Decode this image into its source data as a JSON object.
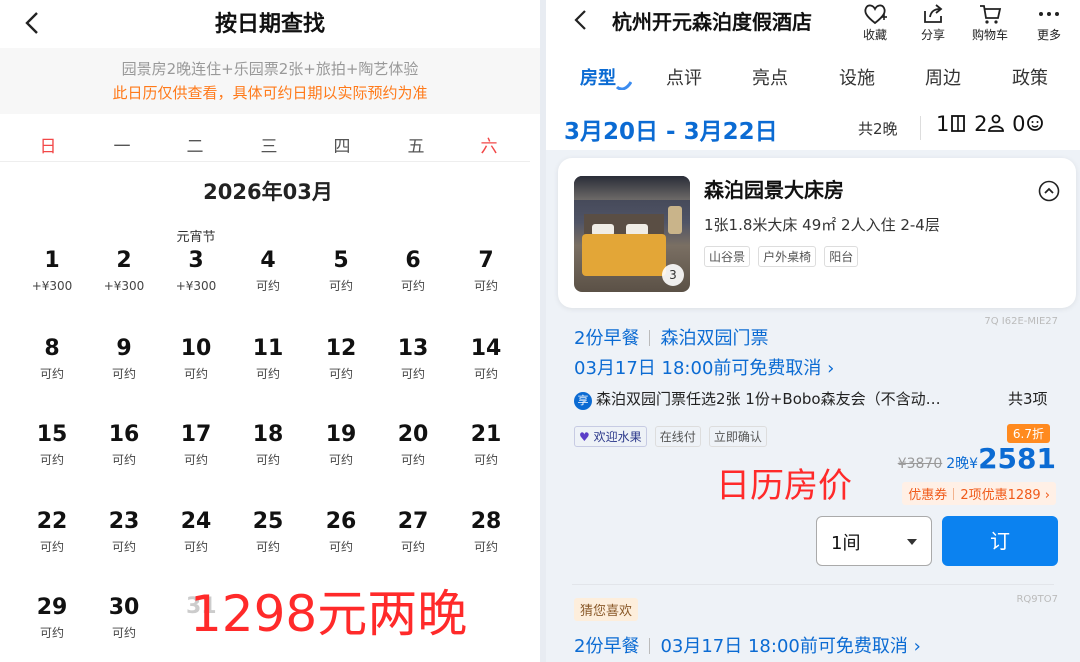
{
  "left": {
    "title": "按日期查找",
    "notice_line1": "园景房2晚连住+乐园票2张+旅拍+陶艺体验",
    "notice_line2": "此日历仅供查看，具体可约日期以实际预约为准",
    "weekdays": [
      "日",
      "一",
      "二",
      "三",
      "四",
      "五",
      "六"
    ],
    "month": "2026年03月",
    "days": [
      {
        "num": "1",
        "sub": "+¥300",
        "festival": ""
      },
      {
        "num": "2",
        "sub": "+¥300",
        "festival": ""
      },
      {
        "num": "3",
        "sub": "+¥300",
        "festival": "元宵节"
      },
      {
        "num": "4",
        "sub": "可约",
        "festival": ""
      },
      {
        "num": "5",
        "sub": "可约",
        "festival": ""
      },
      {
        "num": "6",
        "sub": "可约",
        "festival": ""
      },
      {
        "num": "7",
        "sub": "可约",
        "festival": ""
      },
      {
        "num": "8",
        "sub": "可约",
        "festival": ""
      },
      {
        "num": "9",
        "sub": "可约",
        "festival": ""
      },
      {
        "num": "10",
        "sub": "可约",
        "festival": ""
      },
      {
        "num": "11",
        "sub": "可约",
        "festival": ""
      },
      {
        "num": "12",
        "sub": "可约",
        "festival": ""
      },
      {
        "num": "13",
        "sub": "可约",
        "festival": ""
      },
      {
        "num": "14",
        "sub": "可约",
        "festival": ""
      },
      {
        "num": "15",
        "sub": "可约",
        "festival": ""
      },
      {
        "num": "16",
        "sub": "可约",
        "festival": ""
      },
      {
        "num": "17",
        "sub": "可约",
        "festival": ""
      },
      {
        "num": "18",
        "sub": "可约",
        "festival": ""
      },
      {
        "num": "19",
        "sub": "可约",
        "festival": ""
      },
      {
        "num": "20",
        "sub": "可约",
        "festival": ""
      },
      {
        "num": "21",
        "sub": "可约",
        "festival": ""
      },
      {
        "num": "22",
        "sub": "可约",
        "festival": ""
      },
      {
        "num": "23",
        "sub": "可约",
        "festival": ""
      },
      {
        "num": "24",
        "sub": "可约",
        "festival": ""
      },
      {
        "num": "25",
        "sub": "可约",
        "festival": ""
      },
      {
        "num": "26",
        "sub": "可约",
        "festival": ""
      },
      {
        "num": "27",
        "sub": "可约",
        "festival": ""
      },
      {
        "num": "28",
        "sub": "可约",
        "festival": ""
      },
      {
        "num": "29",
        "sub": "可约",
        "festival": ""
      },
      {
        "num": "30",
        "sub": "可约",
        "festival": ""
      }
    ],
    "partial_day": "31",
    "overlay_text": "1298元两晚"
  },
  "right": {
    "hotel_name": "杭州开元森泊度假酒店",
    "toolbar": {
      "favorite": "收藏",
      "share": "分享",
      "cart": "购物车",
      "more": "更多"
    },
    "tabs": [
      "房型",
      "点评",
      "亮点",
      "设施",
      "周边",
      "政策"
    ],
    "active_tab": "房型",
    "dates": "3月20日 - 3月22日",
    "nights": "共2晚",
    "rooms": "1",
    "adults": "2",
    "children": "0",
    "room": {
      "name": "森泊园景大床房",
      "info": "1张1.8米大床  49㎡  2人入住  2-4层",
      "tags": [
        "山谷景",
        "户外桌椅",
        "阳台"
      ],
      "photo_count": "3"
    },
    "offer": {
      "code": "7Q I62E-MIE27",
      "breakfast": "2份早餐",
      "ticket": "森泊双园门票",
      "cancel": "03月17日 18:00前可免费取消 ›",
      "bundle_icon": "享",
      "bundle": "森泊双园门票任选2张 1份+Bobo森友会（不含动…",
      "bundle_count": "共3项",
      "tags": [
        "欢迎水果",
        "在线付",
        "立即确认"
      ],
      "discount_badge": "6.7折",
      "original_price": "¥3870",
      "price_prefix": "2晚¥",
      "price": "2581",
      "promo_label": "优惠券",
      "promo_detail": "2项优惠1289 ›",
      "quantity": "1间",
      "book_label": "订"
    },
    "overlay_text": "日历房价",
    "next": {
      "code": "RQ9TO7",
      "guess": "猜您喜欢",
      "breakfast": "2份早餐",
      "cancel": "03月17日 18:00前可免费取消 ›"
    },
    "colors": {
      "accent_blue": "#0b6bd3",
      "book_blue": "#0b82f0",
      "warning_orange": "#ff7a1a",
      "overlay_red": "#ff2a2a"
    }
  }
}
